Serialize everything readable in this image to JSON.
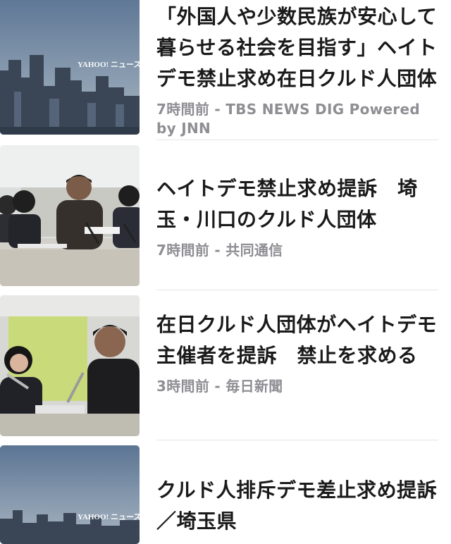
{
  "articles": [
    {
      "title": "「外国人や少数民族が安心して暮らせる社会を目指す」ヘイトデモ禁止求め在日クルド人団体",
      "time": "7時間前",
      "separator": " - ",
      "source": "TBS NEWS DIG Powered by JNN",
      "thumbnail_watermark": "YAHOO! ニュース"
    },
    {
      "title": "ヘイトデモ禁止求め提訴　埼玉・川口のクルド人団体",
      "time": "7時間前",
      "separator": " - ",
      "source": "共同通信"
    },
    {
      "title": "在日クルド人団体がヘイトデモ主催者を提訴　禁止を求める",
      "time": "3時間前",
      "separator": " - ",
      "source": "毎日新聞"
    },
    {
      "title": "クルド人排斥デモ差止求め提訴／埼玉県",
      "thumbnail_watermark": "YAHOO! ニュース"
    }
  ]
}
